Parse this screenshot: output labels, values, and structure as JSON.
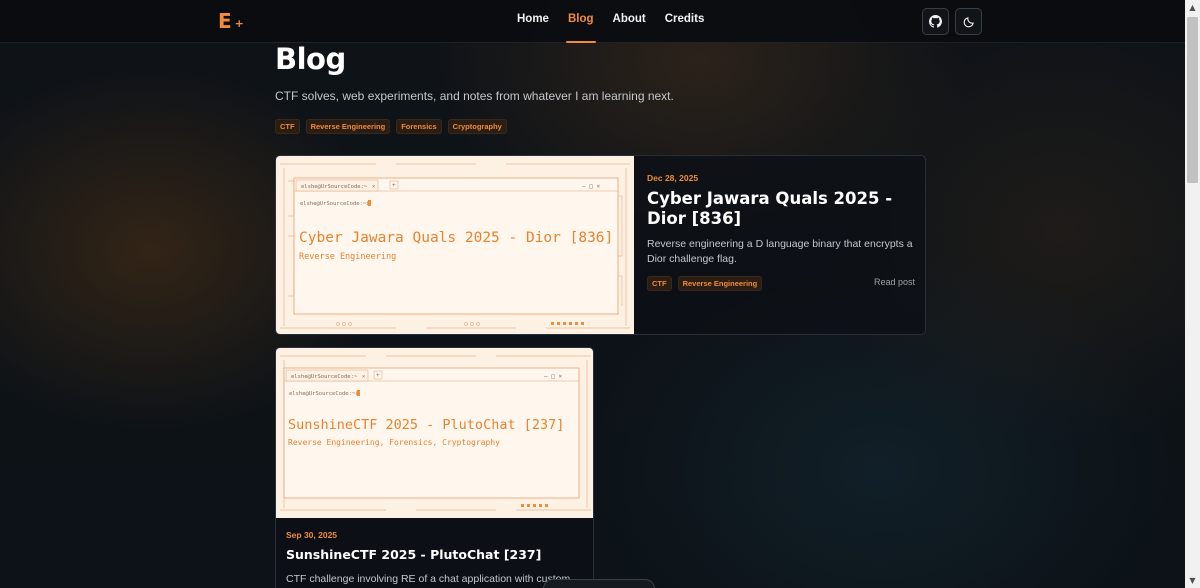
{
  "brand": {
    "logo": "E",
    "logo_plus": "+"
  },
  "nav": {
    "links": [
      "Home",
      "Blog",
      "About",
      "Credits"
    ],
    "active": "Blog"
  },
  "header": {
    "title": "Blog",
    "description": "CTF solves, web experiments, and notes from whatever I am learning next.",
    "tags": [
      "CTF",
      "Reverse Engineering",
      "Forensics",
      "Cryptography"
    ]
  },
  "posts": [
    {
      "date": "Dec 28, 2025",
      "title": "Cyber Jawara Quals 2025 - Dior [836]",
      "excerpt": "Reverse engineering a D language binary that encrypts a Dior challenge flag.",
      "tags": [
        "CTF",
        "Reverse Engineering"
      ],
      "link": "Read post",
      "thumb": {
        "terminal_tab": "elshe@UrSourceCode:~",
        "prompt": "elshe@UrSourceCode:~$",
        "title": "Cyber Jawara Quals 2025 - Dior [836]",
        "subtitle": "Reverse Engineering"
      }
    },
    {
      "date": "Sep 30, 2025",
      "title": "SunshineCTF 2025 - PlutoChat [237]",
      "excerpt": "CTF challenge involving RE of a chat application with custom",
      "thumb": {
        "terminal_tab": "elshe@UrSourceCode:~",
        "prompt": "elshe@UrSourceCode:~$",
        "title": "SunshineCTF 2025 - PlutoChat [237]",
        "subtitle": "Reverse Engineering, Forensics, Cryptography"
      }
    }
  ],
  "colors": {
    "accent": "#f08c3a",
    "background": "#0d1117",
    "card_thumb": "#fdf1e4"
  },
  "icons": {
    "github": "github-icon",
    "theme": "moon-icon"
  }
}
